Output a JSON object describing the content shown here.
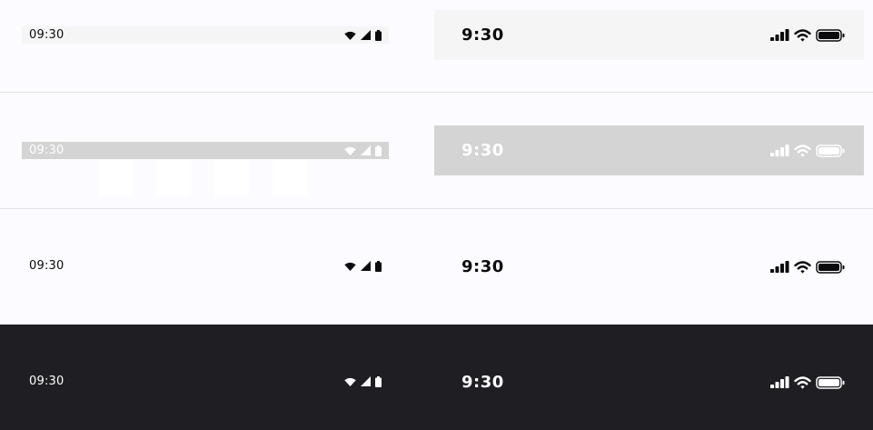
{
  "colors": {
    "page_background": "#fcfbff",
    "dark_background": "#1f1e23",
    "light_bar": "#f5f5f5",
    "gray_bar": "#d4d4d4",
    "dark_icon": "#0b0b0d",
    "light_icon": "#ffffff"
  },
  "status_bars": [
    {
      "android": {
        "time": "09:30",
        "icons": [
          "wifi-icon",
          "signal-icon",
          "battery-icon"
        ]
      },
      "ios": {
        "time": "9:30",
        "icons": [
          "signal-bars-icon",
          "wifi-icon",
          "battery-icon"
        ]
      }
    },
    {
      "android": {
        "time": "09:30",
        "icons": [
          "wifi-icon",
          "signal-icon",
          "battery-icon"
        ]
      },
      "ios": {
        "time": "9:30",
        "icons": [
          "signal-bars-icon",
          "wifi-icon",
          "battery-icon"
        ]
      }
    },
    {
      "android": {
        "time": "09:30",
        "icons": [
          "wifi-icon",
          "signal-icon",
          "battery-icon"
        ]
      },
      "ios": {
        "time": "9:30",
        "icons": [
          "signal-bars-icon",
          "wifi-icon",
          "battery-icon"
        ]
      }
    },
    {
      "android": {
        "time": "09:30",
        "icons": [
          "wifi-icon",
          "signal-icon",
          "battery-icon"
        ]
      },
      "ios": {
        "time": "9:30",
        "icons": [
          "signal-bars-icon",
          "wifi-icon",
          "battery-icon"
        ]
      }
    }
  ]
}
